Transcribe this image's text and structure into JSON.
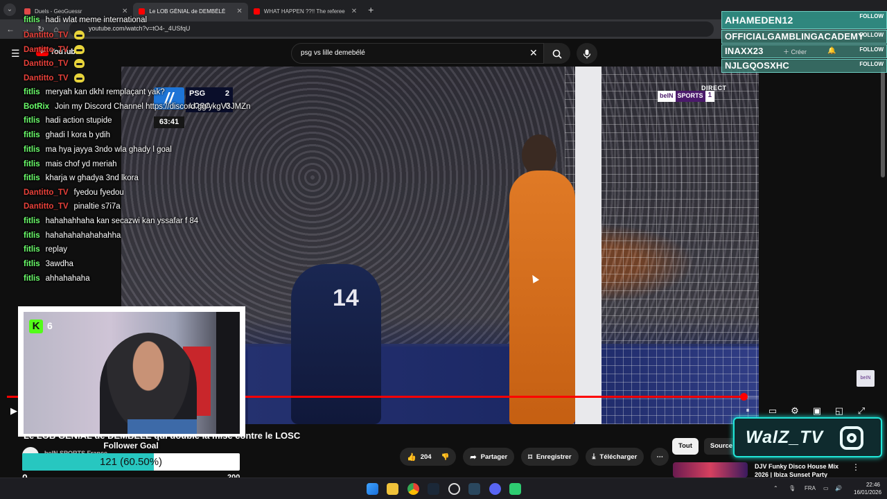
{
  "browser": {
    "tabs": [
      {
        "label": "Duels - GeoGuessr",
        "color": "#e04848"
      },
      {
        "label": "Le LOB GÉNIAL de DEMBÉLÉ",
        "color": "#ff0000"
      },
      {
        "label": "WHAT HAPPEN ??!! The referee",
        "color": "#ff0000"
      }
    ],
    "url": "youtube.com/watch?v=tO4-_4USfqU"
  },
  "youtube": {
    "logo": "YouTube",
    "search_value": "psg vs lille demebélé",
    "video": {
      "score": {
        "team1": "PSG",
        "score1": "2",
        "team2": "LOSC",
        "score2": "0",
        "clock": "63:41"
      },
      "live_label": "DIRECT",
      "broadcaster": {
        "a": "beIN",
        "b": "SPORTS",
        "c": "1"
      },
      "jersey_number": "14",
      "progress": 0.98
    },
    "title": "Le LOB GÉNIAL de DEMBÉLÉ qui double la mise contre le LOSC",
    "channel": "beIN SPORTS France",
    "actions": {
      "likes": "204",
      "share": "Partager",
      "save": "Enregistrer",
      "download": "Télécharger"
    },
    "chips": {
      "all": "Tout",
      "source": "Source"
    },
    "recommended": {
      "title": "DJV Funky Disco House Mix 2026 | Ibiza Sunset Party"
    }
  },
  "chat": [
    {
      "user": "fitlis",
      "text": "hadi wlat meme international",
      "color": "#6bff6b",
      "emote": false
    },
    {
      "user": "Dantitto_TV",
      "text": "",
      "color": "#e8413a",
      "emote": true
    },
    {
      "user": "Dantitto_TV",
      "text": "",
      "color": "#e8413a",
      "emote": true
    },
    {
      "user": "Dantitto_TV",
      "text": "",
      "color": "#e8413a",
      "emote": true
    },
    {
      "user": "Dantitto_TV",
      "text": "",
      "color": "#e8413a",
      "emote": true
    },
    {
      "user": "fitlis",
      "text": "meryah kan dkhl remplaçant yak?",
      "color": "#6bff6b",
      "emote": false
    },
    {
      "user": "BotRix",
      "text": "Join my Discord Channel https://discord.gg/ykgV3JMZn",
      "color": "#6bff6b",
      "emote": false
    },
    {
      "user": "fitlis",
      "text": "hadi action stupide",
      "color": "#6bff6b",
      "emote": false
    },
    {
      "user": "fitlis",
      "text": "ghadi l kora b ydih",
      "color": "#6bff6b",
      "emote": false
    },
    {
      "user": "fitlis",
      "text": "ma hya jayya 3ndo wla ghady l goal",
      "color": "#6bff6b",
      "emote": false
    },
    {
      "user": "fitlis",
      "text": "mais chof yd meriah",
      "color": "#6bff6b",
      "emote": false
    },
    {
      "user": "fitlis",
      "text": "kharja w ghadya 3nd lkora",
      "color": "#6bff6b",
      "emote": false
    },
    {
      "user": "Dantitto_TV",
      "text": "fyedou fyedou",
      "color": "#e8413a",
      "emote": false
    },
    {
      "user": "Dantitto_TV",
      "text": "pinaltie s7i7a",
      "color": "#e8413a",
      "emote": false
    },
    {
      "user": "fitlis",
      "text": "hahahahhaha kan secazwi kan yssafar f 84",
      "color": "#6bff6b",
      "emote": false
    },
    {
      "user": "fitlis",
      "text": "hahahahahahahahha",
      "color": "#6bff6b",
      "emote": false
    },
    {
      "user": "fitlis",
      "text": "replay",
      "color": "#6bff6b",
      "emote": false
    },
    {
      "user": "fitlis",
      "text": "3awdha",
      "color": "#6bff6b",
      "emote": false
    },
    {
      "user": "fitlis",
      "text": "ahhahahaha",
      "color": "#6bff6b",
      "emote": false
    }
  ],
  "followers": [
    {
      "name": "AHAMEDEN12",
      "tag": "FOLLOW"
    },
    {
      "name": "OFFICIALGAMBLINGACADEMY",
      "tag": "FOLLOW"
    },
    {
      "name": "INAXX23",
      "tag": "FOLLOW"
    },
    {
      "name": "NJLGQOSXHC",
      "tag": "FOLLOW"
    }
  ],
  "create_label": "Créer",
  "webcam": {
    "kick_logo": "K",
    "viewers": "6"
  },
  "follower_goal": {
    "title": "Follower Goal",
    "text": "121 (60.50%)",
    "progress": 0.605,
    "min": "0",
    "max": "200"
  },
  "brand": {
    "name": "WalZ_TV"
  },
  "taskbar": {
    "lang": "FRA",
    "time": "22:46",
    "date": "16/01/2026"
  }
}
